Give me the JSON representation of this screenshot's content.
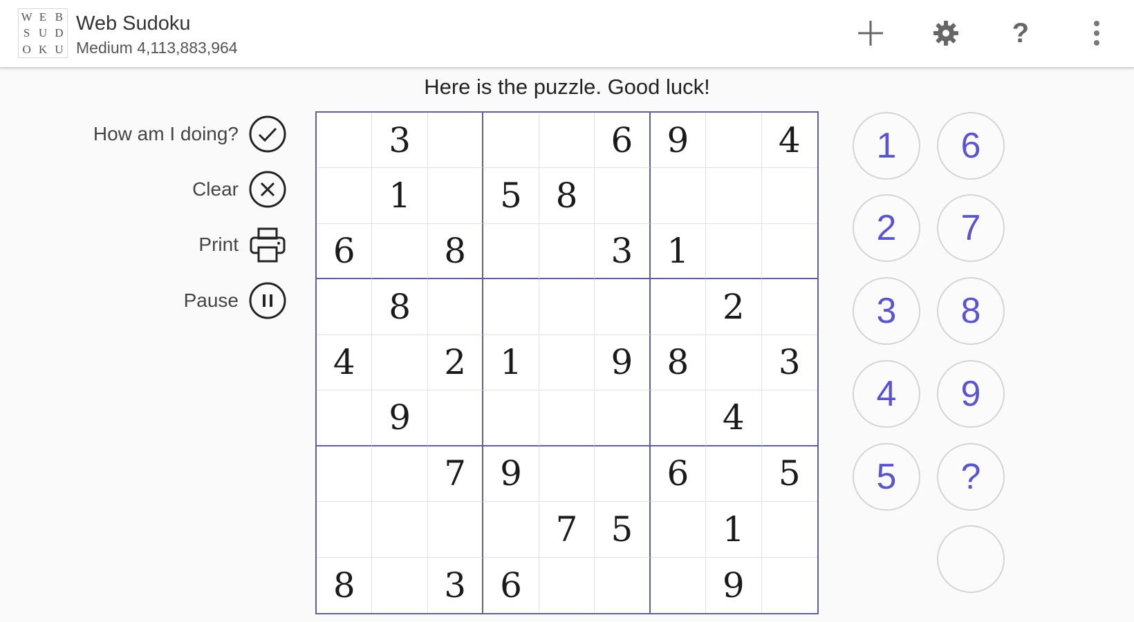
{
  "app": {
    "logo_letters": [
      "W",
      "E",
      "B",
      "S",
      "U",
      "D",
      "O",
      "K",
      "U"
    ],
    "title": "Web Sudoku",
    "subtitle": "Medium 4,113,883,964"
  },
  "toolbar": {
    "icons": [
      "plus-icon",
      "gear-icon",
      "question-mark-icon",
      "more-vert-icon"
    ]
  },
  "message": "Here is the puzzle. Good luck!",
  "actions": [
    {
      "label": "How am I doing?",
      "icon": "check-circle-icon"
    },
    {
      "label": "Clear",
      "icon": "close-circle-icon"
    },
    {
      "label": "Print",
      "icon": "printer-icon"
    },
    {
      "label": "Pause",
      "icon": "pause-circle-icon"
    }
  ],
  "puzzle": [
    [
      "",
      "3",
      "",
      "",
      "",
      "6",
      "9",
      "",
      "4"
    ],
    [
      "",
      "1",
      "",
      "5",
      "8",
      "",
      "",
      "",
      ""
    ],
    [
      "6",
      "",
      "8",
      "",
      "",
      "3",
      "1",
      "",
      ""
    ],
    [
      "",
      "8",
      "",
      "",
      "",
      "",
      "",
      "2",
      ""
    ],
    [
      "4",
      "",
      "2",
      "1",
      "",
      "9",
      "8",
      "",
      "3"
    ],
    [
      "",
      "9",
      "",
      "",
      "",
      "",
      "",
      "4",
      ""
    ],
    [
      "",
      "",
      "7",
      "9",
      "",
      "",
      "6",
      "",
      "5"
    ],
    [
      "",
      "",
      "",
      "",
      "7",
      "5",
      "",
      "1",
      ""
    ],
    [
      "8",
      "",
      "3",
      "6",
      "",
      "",
      "",
      "9",
      ""
    ]
  ],
  "pad": {
    "left": [
      "1",
      "2",
      "3",
      "4",
      "5"
    ],
    "right": [
      "6",
      "7",
      "8",
      "9",
      "?",
      ""
    ]
  },
  "colors": {
    "accent": "#5a55cf",
    "grid_border": "#5e5e9c"
  }
}
